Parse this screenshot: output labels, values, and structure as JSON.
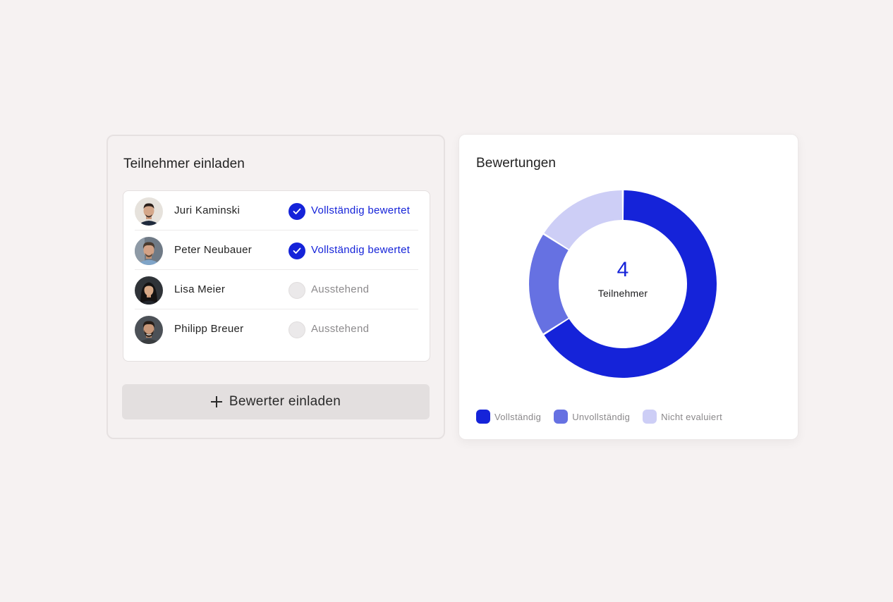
{
  "invite_panel": {
    "title": "Teilnehmer einladen",
    "participants": [
      {
        "name": "Juri Kaminski",
        "status": "Vollständig bewertet",
        "state": "done",
        "avatar": "avatar-man-dark-hair"
      },
      {
        "name": "Peter Neubauer",
        "status": "Vollständig bewertet",
        "state": "done",
        "avatar": "avatar-man-curly-hair"
      },
      {
        "name": "Lisa Meier",
        "status": "Ausstehend",
        "state": "pending",
        "avatar": "avatar-woman-long-hair"
      },
      {
        "name": "Philipp Breuer",
        "status": "Ausstehend",
        "state": "pending",
        "avatar": "avatar-man-beard"
      }
    ],
    "invite_button_label": "Bewerter einladen",
    "invite_button_icon": "plus-icon"
  },
  "ratings_panel": {
    "title": "Bewertungen",
    "center_count": "4",
    "center_label": "Teilnehmer",
    "legend": [
      {
        "label": "Vollständig",
        "color": "#1523d9"
      },
      {
        "label": "Unvollständig",
        "color": "#6671e2"
      },
      {
        "label": "Nicht evaluiert",
        "color": "#cdcef6"
      }
    ]
  },
  "chart_data": {
    "type": "pie",
    "categories": [
      "Vollständig",
      "Unvollständig",
      "Nicht evaluiert"
    ],
    "values": [
      66,
      18,
      16
    ],
    "colors": [
      "#1523d9",
      "#6671e2",
      "#cdcef6"
    ],
    "legend_position": "bottom-left"
  },
  "colors": {
    "accent": "#1523d9",
    "pending_text": "#8c8a8c",
    "background": "#f6f2f2"
  }
}
